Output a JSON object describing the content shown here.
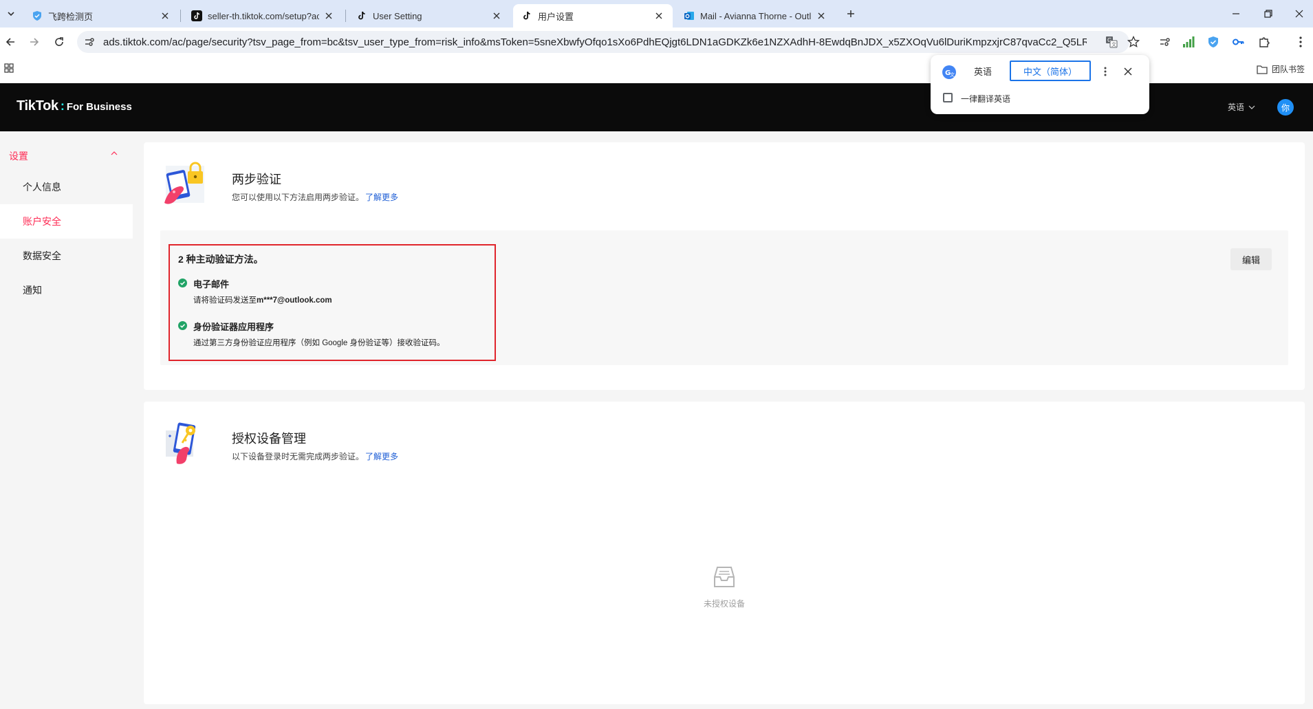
{
  "browser": {
    "tabs": [
      {
        "title": "飞跨检测页",
        "active": false
      },
      {
        "title": "seller-th.tiktok.com/setup?ac",
        "active": false
      },
      {
        "title": "User Setting",
        "active": false
      },
      {
        "title": "用户设置",
        "active": true
      },
      {
        "title": "Mail - Avianna Thorne - Outl",
        "active": false
      }
    ],
    "url": "ads.tiktok.com/ac/page/security?tsv_page_from=bc&tsv_user_type_from=risk_info&msToken=5sneXbwfyOfqo1sXo6PdhEQjgt6LDN1aGDKZk6e1NZXAdhH-8EwdqBnJDX_x5ZXOqVu6lDuriKmpzxjrC87qvaCc2_Q5LR7B...",
    "bookmark_folder": "团队书签"
  },
  "translate": {
    "source_lang": "英语",
    "target_lang": "中文（简体）",
    "always_translate_label": "一律翻译英语",
    "always_translate_checked": false
  },
  "header": {
    "brand_main": "TikTok",
    "brand_sep": ":",
    "brand_sub": "For Business",
    "language": "英语",
    "avatar_text": "你"
  },
  "sidebar": {
    "group_label": "设置",
    "items": [
      {
        "label": "个人信息",
        "active": false
      },
      {
        "label": "账户安全",
        "active": true
      },
      {
        "label": "数据安全",
        "active": false
      },
      {
        "label": "通知",
        "active": false
      }
    ]
  },
  "two_step": {
    "title": "两步验证",
    "description": "您可以使用以下方法启用两步验证。",
    "learn_more": "了解更多",
    "methods_count": "2 种主动验证方法。",
    "methods": [
      {
        "title": "电子邮件",
        "desc_prefix": "请将验证码发送至",
        "desc_bold": "m***7@outlook.com",
        "desc_suffix": ""
      },
      {
        "title": "身份验证器应用程序",
        "desc_prefix": "通过第三方身份验证应用程序（例如 Google 身份验证等）接收验证码。",
        "desc_bold": "",
        "desc_suffix": ""
      }
    ],
    "edit_label": "编辑"
  },
  "devices": {
    "title": "授权设备管理",
    "description": "以下设备登录时无需完成两步验证。",
    "learn_more": "了解更多",
    "empty_label": "未授权设备"
  },
  "colors": {
    "accent": "#fe2c55",
    "link": "#1f5fd6",
    "check": "#21a366",
    "highlight_border": "#e0242b",
    "header_bg": "#0b0b0b",
    "avatar": "#1f8ff5"
  }
}
